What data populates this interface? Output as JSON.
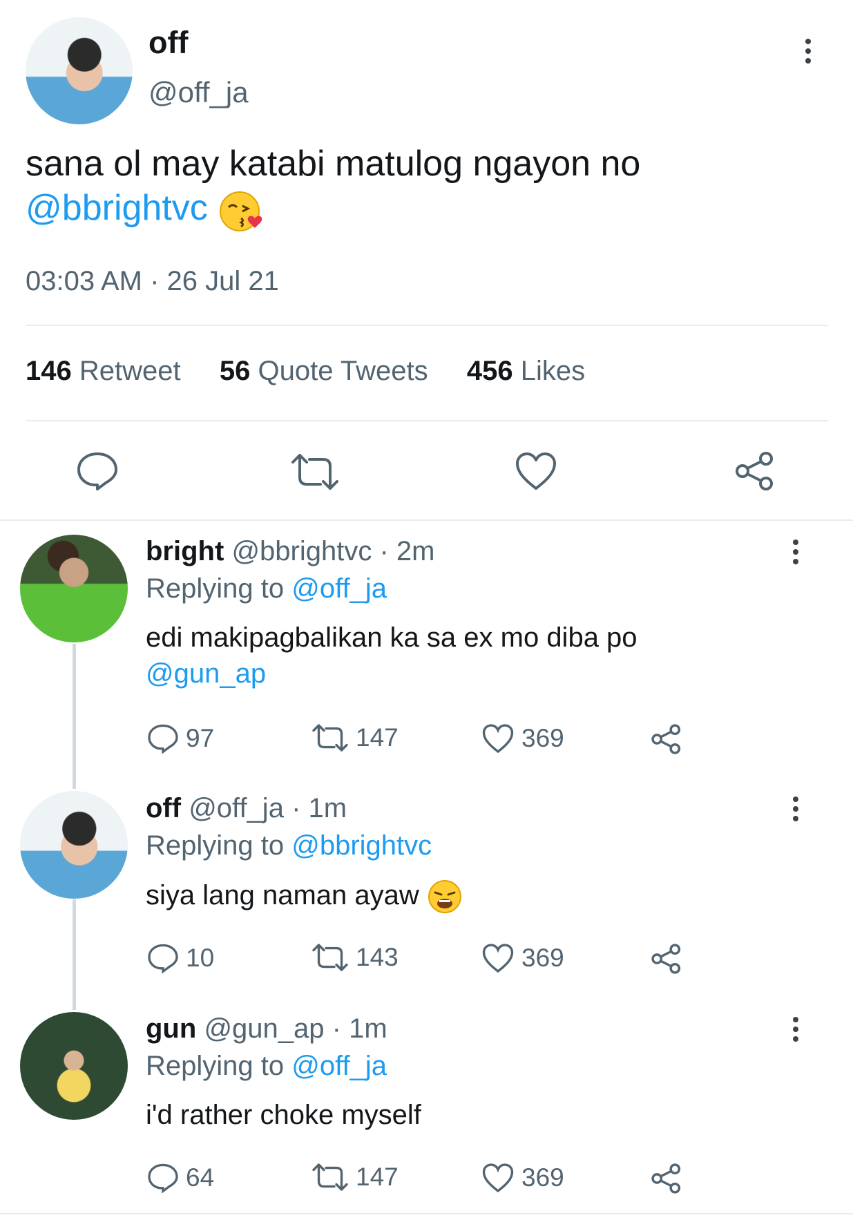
{
  "main_tweet": {
    "display_name": "off",
    "handle": "@off_ja",
    "text": "sana ol may katabi matulog ngayon no",
    "mention": "@bbrightvc",
    "timestamp": "03:03 AM · 26 Jul 21",
    "stats": {
      "retweets_count": "146",
      "retweets_label": "Retweet",
      "quotes_count": "56",
      "quotes_label": "Quote Tweets",
      "likes_count": "456",
      "likes_label": "Likes"
    }
  },
  "replies": [
    {
      "display_name": "bright",
      "handle": "@bbrightvc",
      "time": "· 2m",
      "replying_label": "Replying to",
      "replying_to": "@off_ja",
      "text": "edi makipagbalikan ka sa ex mo diba po",
      "mention": "@gun_ap",
      "replies": "97",
      "retweets": "147",
      "likes": "369"
    },
    {
      "display_name": "off",
      "handle": "@off_ja",
      "time": "· 1m",
      "replying_label": "Replying to",
      "replying_to": "@bbrightvc",
      "text": "siya lang naman ayaw",
      "replies": "10",
      "retweets": "143",
      "likes": "369"
    },
    {
      "display_name": "gun",
      "handle": "@gun_ap",
      "time": "· 1m",
      "replying_label": "Replying to",
      "replying_to": "@off_ja",
      "text": "i'd rather choke myself",
      "replies": "64",
      "retweets": "147",
      "likes": "369"
    }
  ],
  "colors": {
    "link": "#1d9bf0",
    "muted": "#536471",
    "text": "#14171a",
    "divider": "#e6ecf0"
  }
}
